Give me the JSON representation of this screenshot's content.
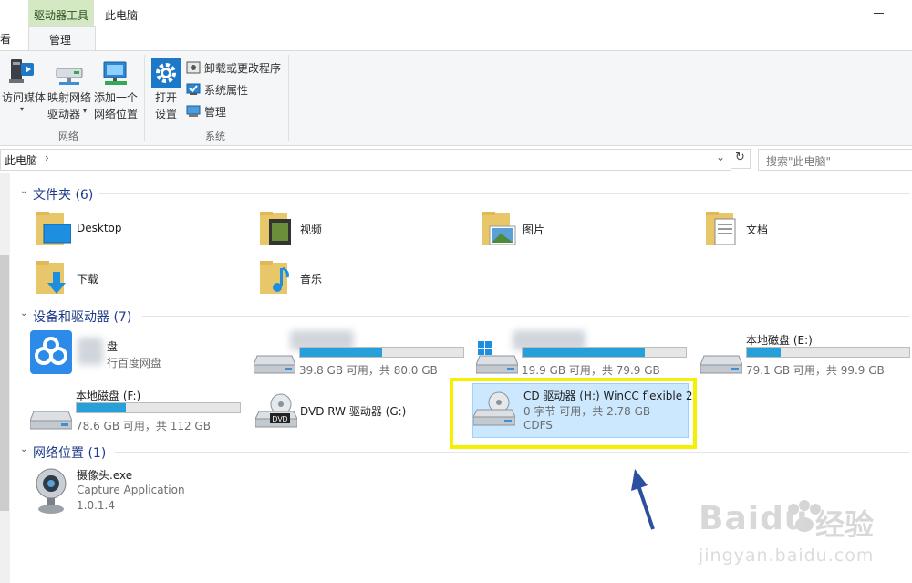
{
  "window": {
    "title": "此电脑",
    "context_header": "驱动器工具",
    "tabs": {
      "view_partial": "查看",
      "manage": "管理"
    }
  },
  "ribbon": {
    "network": {
      "access_media": "访问媒体",
      "map_drive_line1": "映射网络",
      "map_drive_line2": "驱动器",
      "add_location_line1": "添加一个",
      "add_location_line2": "网络位置",
      "group": "网络"
    },
    "system": {
      "open_settings_line1": "打开",
      "open_settings_line2": "设置",
      "uninstall": "卸载或更改程序",
      "properties": "系统属性",
      "manage": "管理",
      "group": "系统"
    }
  },
  "address": {
    "path": "此电脑",
    "search_placeholder": "搜索\"此电脑\""
  },
  "sections": {
    "folders": {
      "title": "文件夹 (6)"
    },
    "devices": {
      "title": "设备和驱动器 (7)"
    },
    "network": {
      "title": "网络位置 (1)"
    }
  },
  "folders": [
    {
      "name": "Desktop"
    },
    {
      "name": "视频"
    },
    {
      "name": "图片"
    },
    {
      "name": "文档"
    },
    {
      "name": "下载"
    },
    {
      "name": "音乐"
    }
  ],
  "drives": {
    "baidu": {
      "name_partial": "盘",
      "sub": "行百度网盘"
    },
    "c": {
      "space": "39.8 GB 可用，共 80.0 GB",
      "used_fraction": 0.5
    },
    "d": {
      "space": "19.9 GB 可用，共 79.9 GB",
      "used_fraction": 0.75
    },
    "e": {
      "name": "本地磁盘 (E:)",
      "space": "79.1 GB 可用，共 99.9 GB",
      "used_fraction": 0.21
    },
    "f": {
      "name": "本地磁盘 (F:)",
      "space": "78.6 GB 可用，共 112 GB",
      "used_fraction": 0.3
    },
    "g": {
      "name": "DVD RW 驱动器 (G:)"
    },
    "h": {
      "name": "CD 驱动器 (H:) WinCC flexible 2",
      "space": "0 字节 可用，共 2.78 GB",
      "fs": "CDFS"
    }
  },
  "network_items": [
    {
      "name": "摄像头.exe",
      "desc": "Capture Application",
      "version": "1.0.1.4"
    }
  ],
  "watermark": {
    "brand": "Baidu",
    "cn": "经验",
    "url": "jingyan.baidu.com"
  },
  "colors": {
    "bar_fill": "#26a0da",
    "highlight": "#f5f000",
    "selection": "#cce8ff",
    "arrow": "#2c4f9e"
  }
}
